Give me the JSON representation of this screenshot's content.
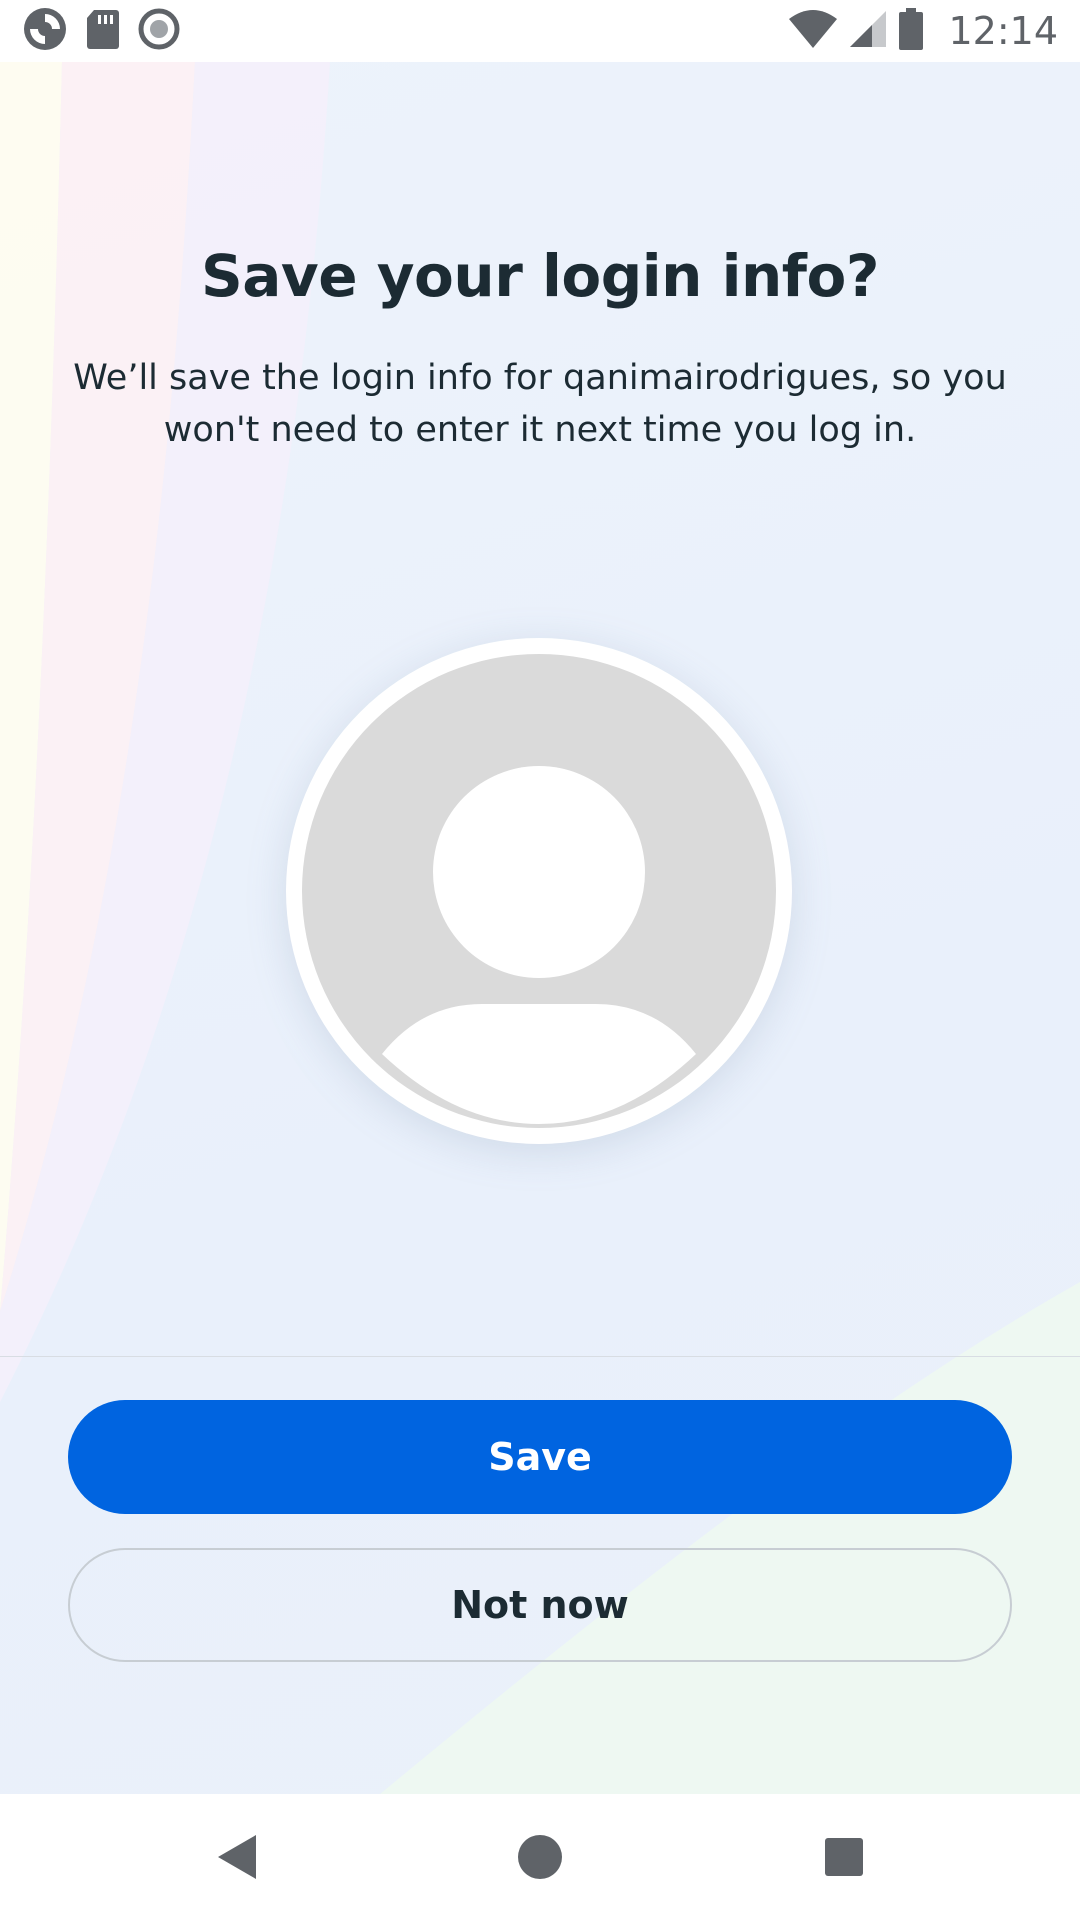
{
  "status_bar": {
    "time": "12:14",
    "left_icons": [
      "app-logo-icon",
      "sd-card-icon",
      "record-icon"
    ],
    "right_icons": [
      "wifi-icon",
      "signal-icon",
      "battery-icon"
    ]
  },
  "dialog": {
    "title": "Save your login info?",
    "message": "We’ll save the login info for qanimairodrigues, so you won't need to enter it next time you log in.",
    "avatar_icon": "default-profile-icon"
  },
  "actions": {
    "save_label": "Save",
    "not_now_label": "Not now"
  },
  "nav_bar": {
    "icons": [
      "back-icon",
      "home-icon",
      "recents-icon"
    ]
  },
  "colors": {
    "primary": "#0064e0",
    "text": "#1c2b33",
    "avatar_bg": "#dadada"
  }
}
